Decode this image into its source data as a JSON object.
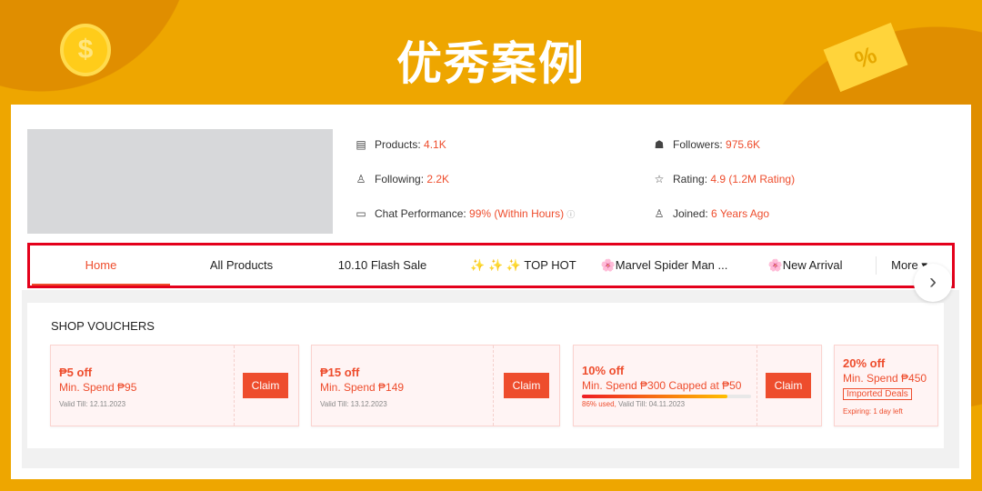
{
  "banner": {
    "title": "优秀案例",
    "coin_symbol": "$",
    "ticket_symbol": "%"
  },
  "stats": [
    {
      "label": "Products: ",
      "value": "4.1K",
      "icon": "store-icon"
    },
    {
      "label": "Following: ",
      "value": "2.2K",
      "icon": "person-icon"
    },
    {
      "label": "Chat Performance: ",
      "value": "99% (Within Hours)",
      "icon": "chat-icon"
    },
    {
      "label": "Followers: ",
      "value": "975.6K",
      "icon": "followers-icon"
    },
    {
      "label": "Rating: ",
      "value": "4.9 (1.2M Rating)",
      "icon": "star-icon"
    },
    {
      "label": "Joined: ",
      "value": "6 Years Ago",
      "icon": "person-icon"
    }
  ],
  "tabs": [
    "Home",
    "All Products",
    "10.10 Flash Sale",
    "✨ ✨ ✨ TOP HOT",
    "🌸Marvel Spider Man ...",
    "🌸New Arrival",
    "More ▾"
  ],
  "vouchers": {
    "title": "SHOP VOUCHERS",
    "claim": "Claim",
    "items": [
      {
        "head": "₱5 off",
        "min": "Min. Spend ₱95",
        "date": "Valid Till: 12.11.2023"
      },
      {
        "head": "₱15 off",
        "min": "Min. Spend ₱149",
        "date": "Valid Till: 13.12.2023"
      },
      {
        "head": "10% off",
        "min": "Min. Spend ₱300 Capped at ₱50",
        "used": "86% used,",
        "date": " Valid Till: 04.11.2023",
        "used_pct": 86
      },
      {
        "head": "20% off",
        "min": "Min. Spend ₱450",
        "tag": "Imported Deals",
        "expiry": "Expiring: 1 day left"
      }
    ]
  },
  "colors": {
    "accent": "#ee4d2d",
    "background": "#eea600",
    "highlight_box": "#e4001b"
  }
}
